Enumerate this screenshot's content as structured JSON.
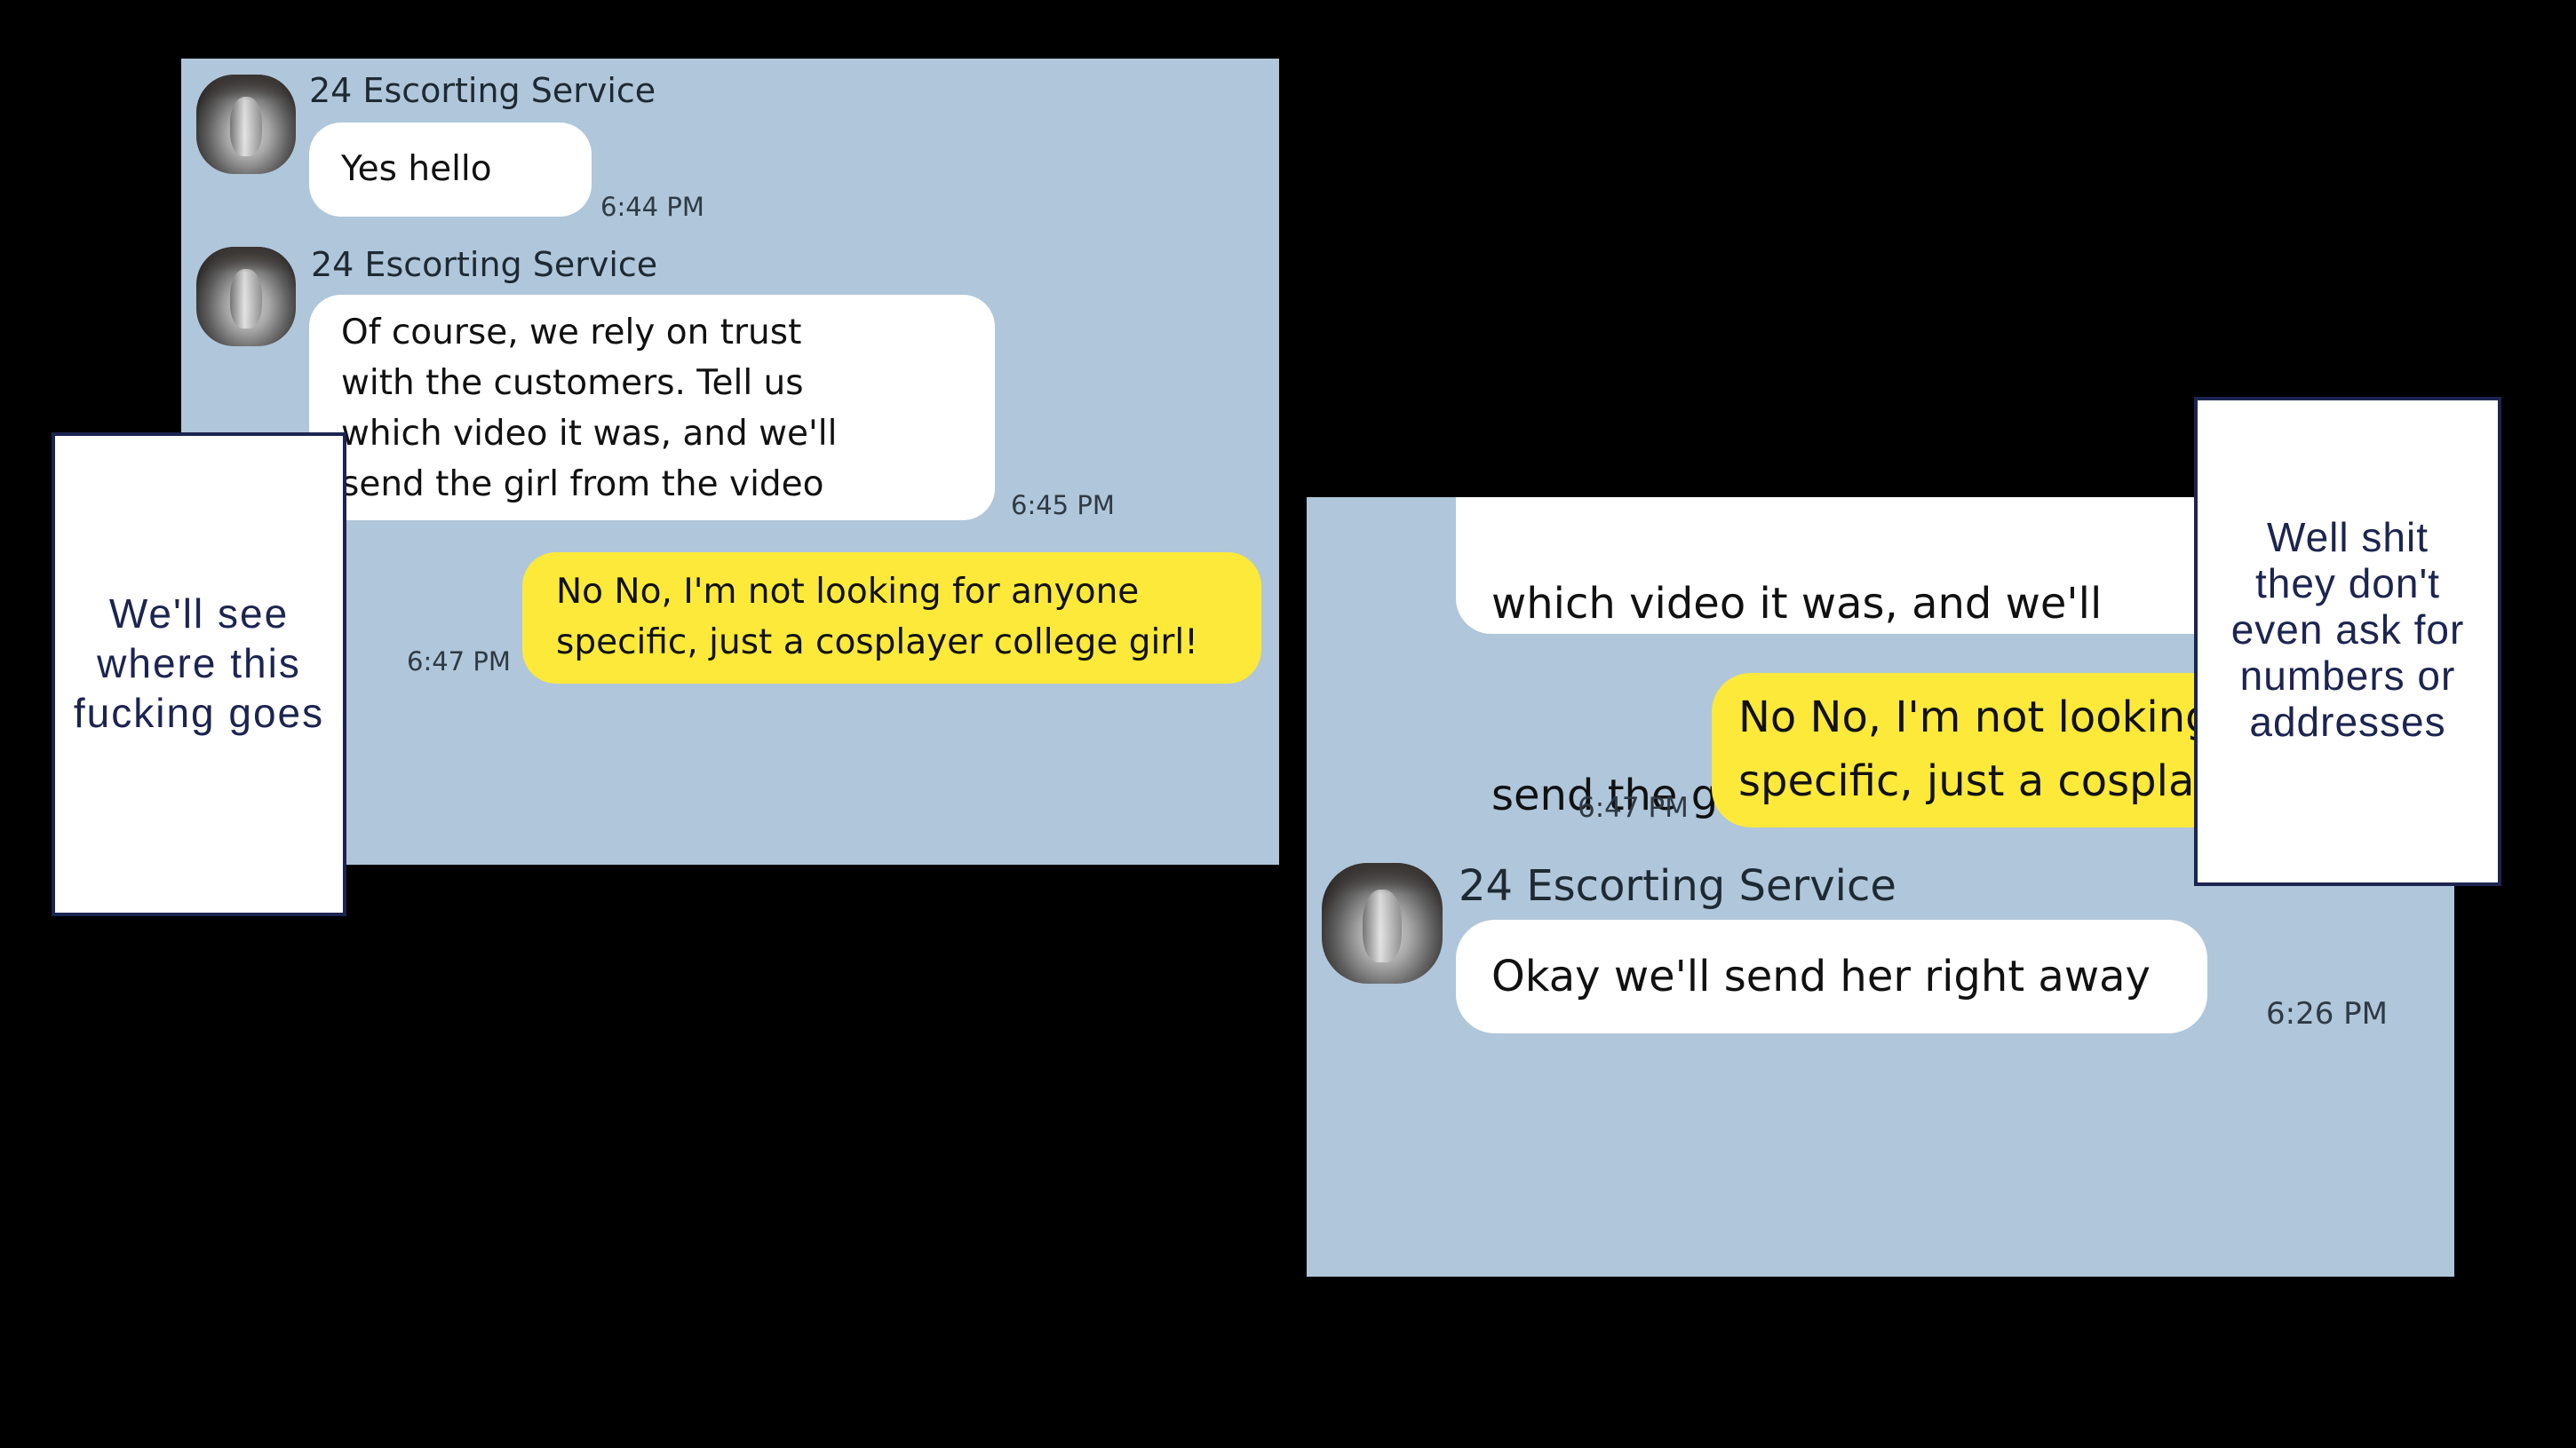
{
  "left_panel": {
    "messages": [
      {
        "sender": "24 Escorting Service",
        "text": "Yes hello",
        "time": "6:44 PM"
      },
      {
        "sender": "24 Escorting Service",
        "lines": [
          "Of course, we rely on trust",
          "with the customers. Tell us",
          "which video it was, and we'll",
          "send the girl from the video"
        ],
        "time": "6:45 PM"
      },
      {
        "lines": [
          "No No, I'm not looking for anyone",
          "specific, just a cosplayer college girl!"
        ],
        "time": "6:47 PM"
      }
    ]
  },
  "right_panel": {
    "messages": [
      {
        "lines": [
          "which video it was, and we'll",
          "send the girl from the video"
        ]
      },
      {
        "lines": [
          "No No, I'm not looking for anyone",
          "specific, just a cosplayer college girl!"
        ],
        "time": "6:47 PM"
      },
      {
        "sender": "24 Escorting Service",
        "text": "Okay we'll send her right away",
        "time": "6:26 PM"
      }
    ]
  },
  "captions": {
    "left": [
      "We'll see",
      "where this",
      "fucking goes"
    ],
    "right": [
      "Well shit",
      "they don't",
      "even ask for",
      "numbers or",
      "addresses"
    ]
  },
  "colors": {
    "chat_background": "#b0c6da",
    "incoming_bubble": "#ffffff",
    "outgoing_bubble": "#fce93a",
    "caption_text": "#1c2450",
    "page_background": "#000000"
  },
  "icons": {
    "contact_avatar": "contact-avatar-photo"
  }
}
